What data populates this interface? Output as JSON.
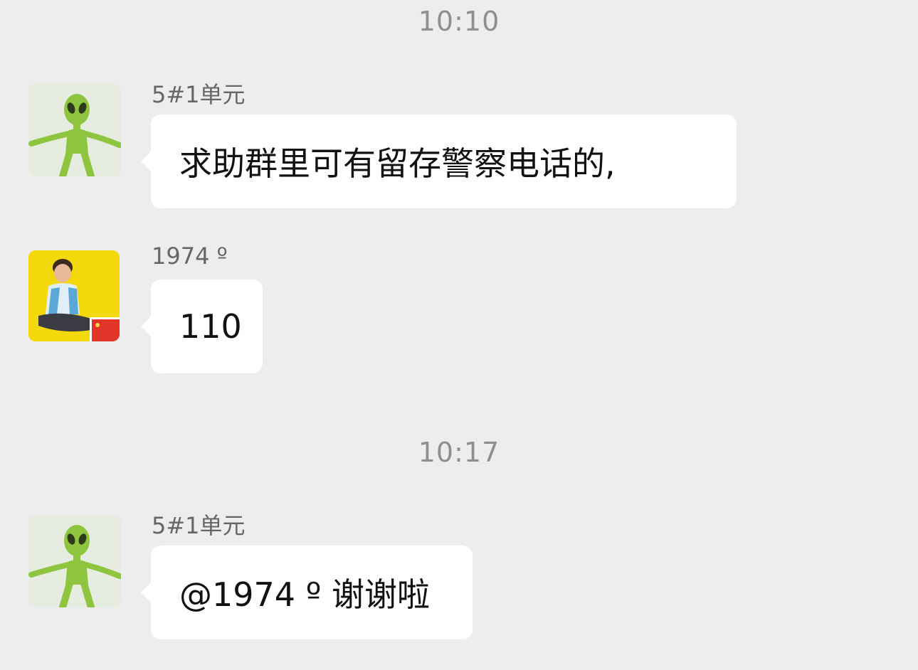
{
  "colors": {
    "background": "#ededed",
    "bubble": "#ffffff",
    "timestamp_text": "#8f8f8f",
    "sender_text": "#666666",
    "message_text": "#111111"
  },
  "chat": {
    "timestamps": [
      "10:10",
      "10:17"
    ],
    "messages": [
      {
        "sender": "5#1单元",
        "avatar": "alien-figure-avatar",
        "text": "求助群里可有留存警察电话的,"
      },
      {
        "sender": "1974 º",
        "avatar": "child-photo-avatar",
        "text": "110"
      },
      {
        "sender": "5#1单元",
        "avatar": "alien-figure-avatar",
        "text": "@1974 º 谢谢啦"
      }
    ]
  }
}
